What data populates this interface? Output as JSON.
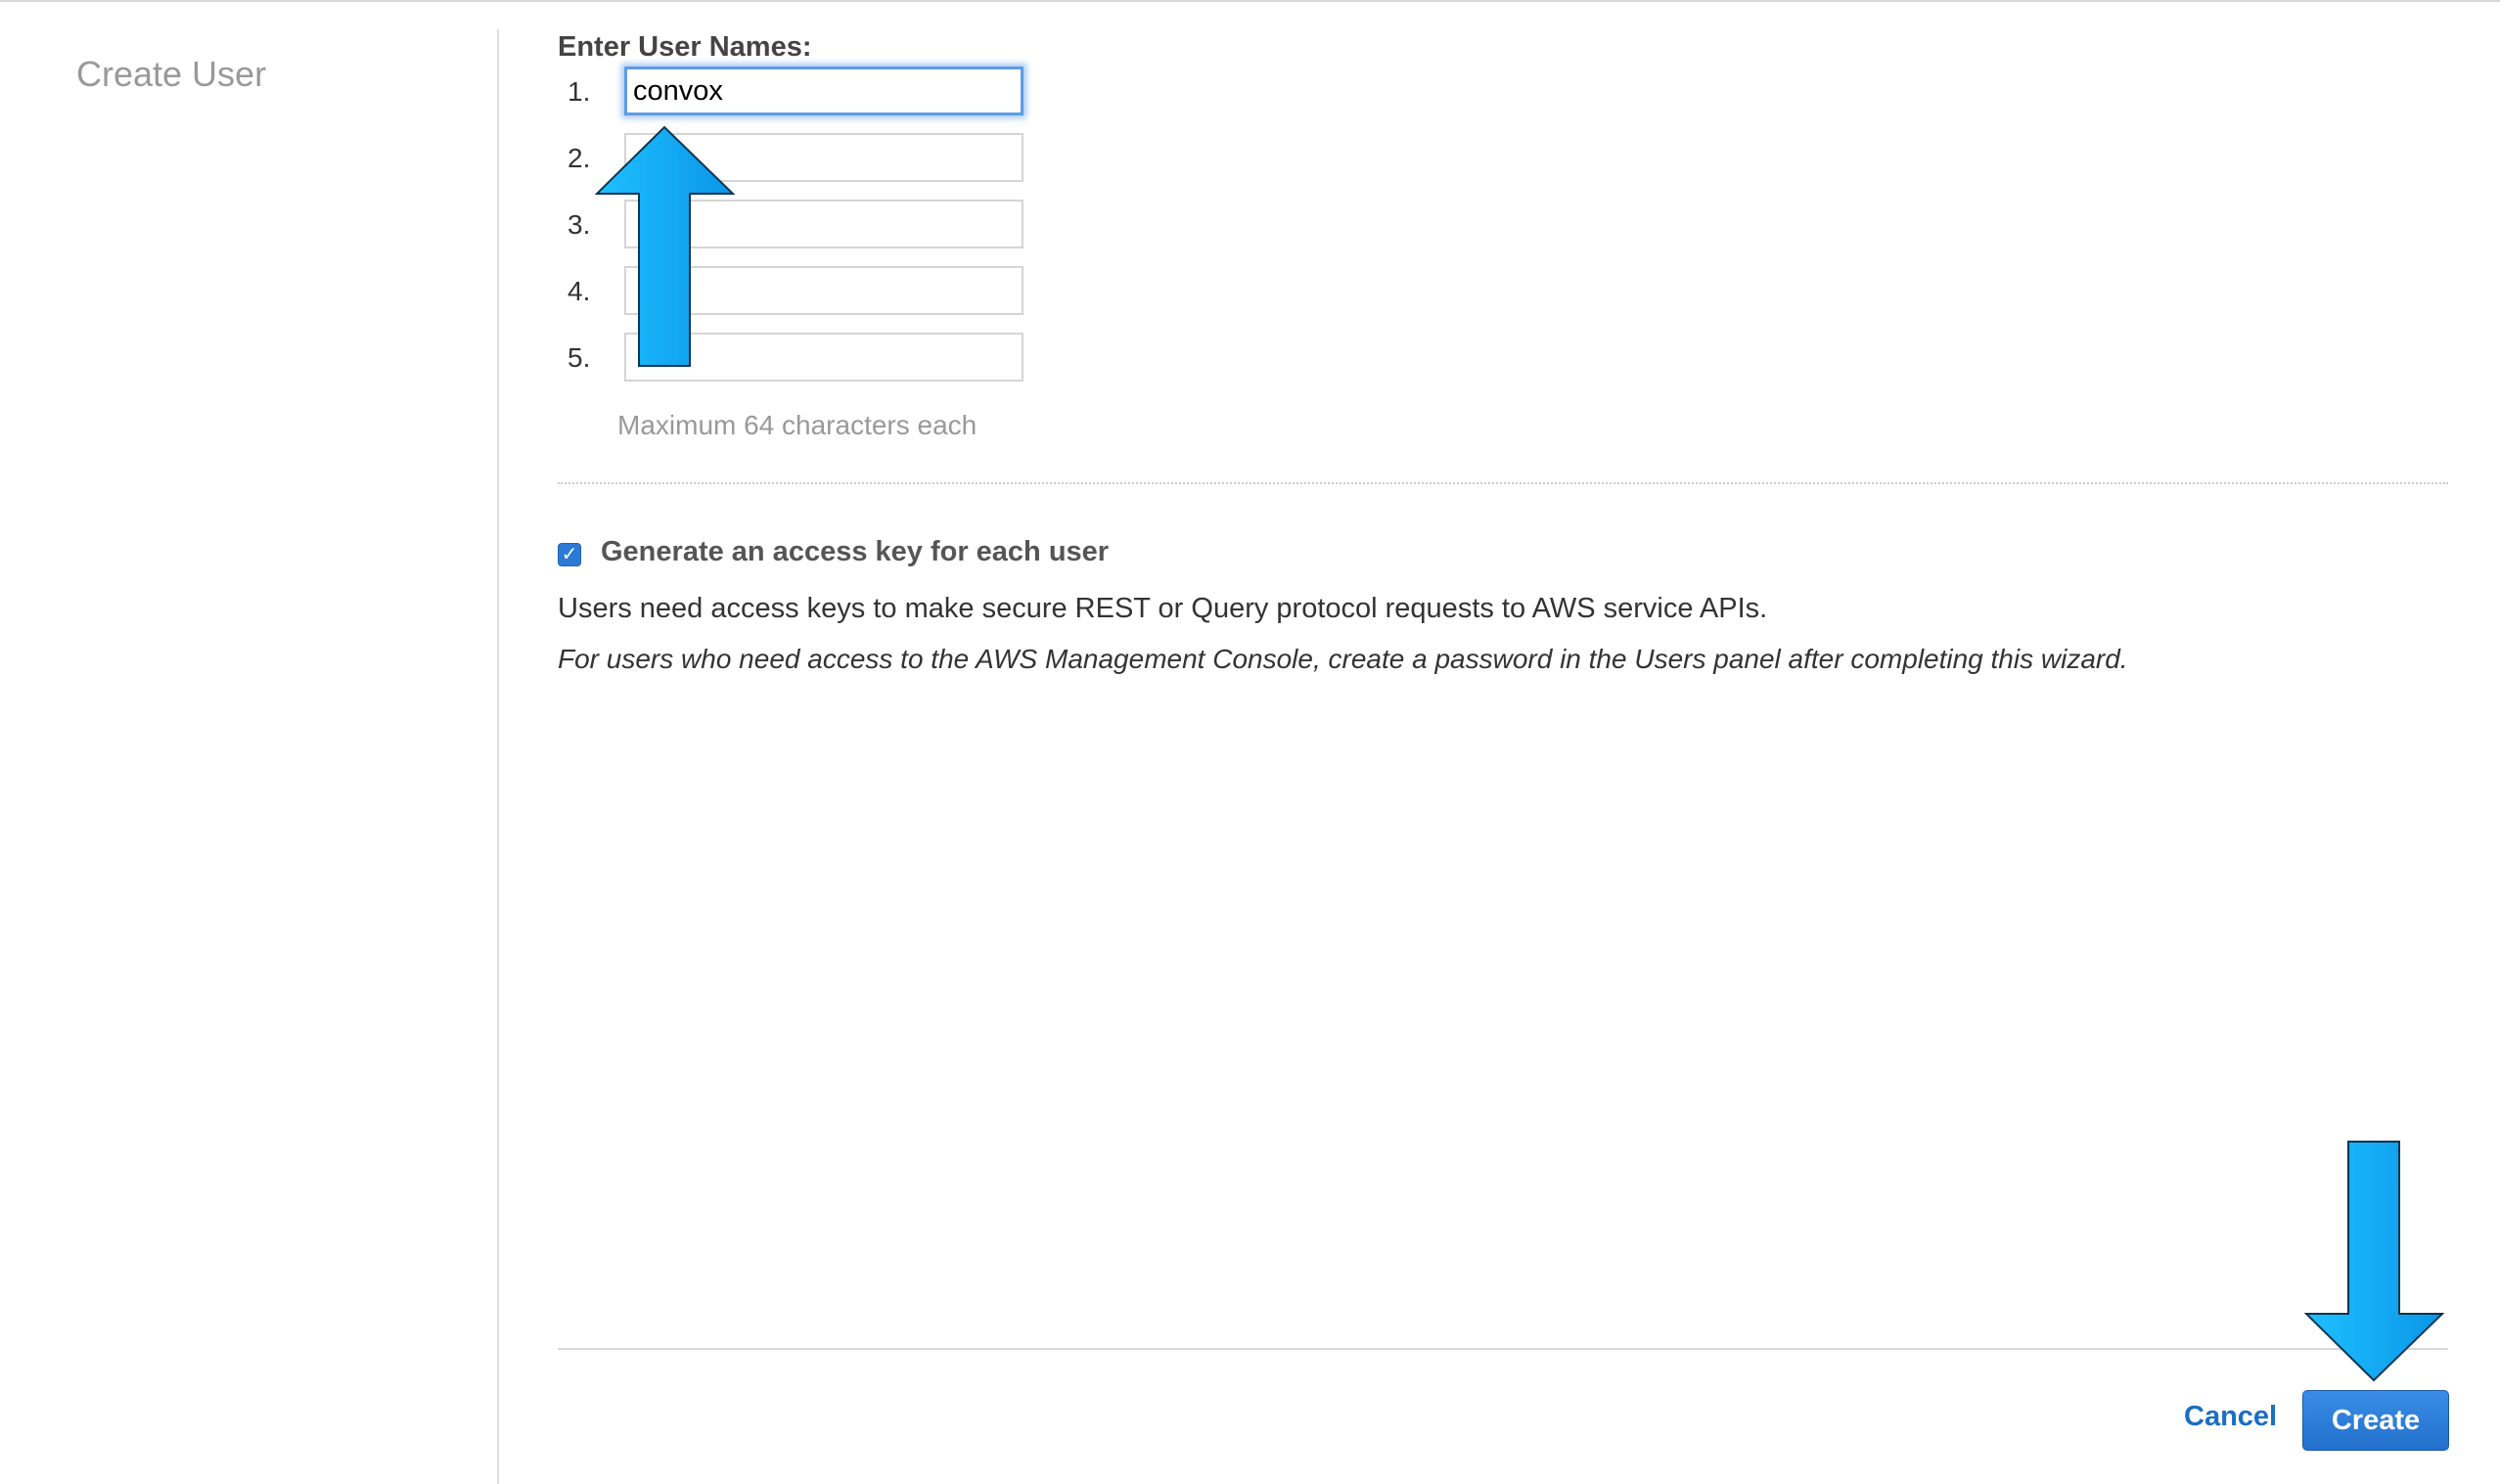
{
  "sidebar": {
    "title": "Create User"
  },
  "form": {
    "section_label": "Enter User Names:",
    "users": [
      {
        "number": "1.",
        "value": "convox"
      },
      {
        "number": "2.",
        "value": ""
      },
      {
        "number": "3.",
        "value": ""
      },
      {
        "number": "4.",
        "value": ""
      },
      {
        "number": "5.",
        "value": ""
      }
    ],
    "hint": "Maximum 64 characters each"
  },
  "access_key": {
    "checked": true,
    "label": "Generate an access key for each user",
    "description": "Users need access keys to make secure REST or Query protocol requests to AWS service APIs.",
    "note": "For users who need access to the AWS Management Console, create a password in the Users panel after completing this wizard."
  },
  "footer": {
    "cancel_label": "Cancel",
    "create_label": "Create"
  },
  "colors": {
    "accent": "#2b7bd6",
    "annotation_arrow": "#0aa6f2",
    "link": "#1a6ec4"
  },
  "annotations": {
    "arrows": [
      "up-arrow-icon",
      "down-arrow-icon"
    ]
  }
}
